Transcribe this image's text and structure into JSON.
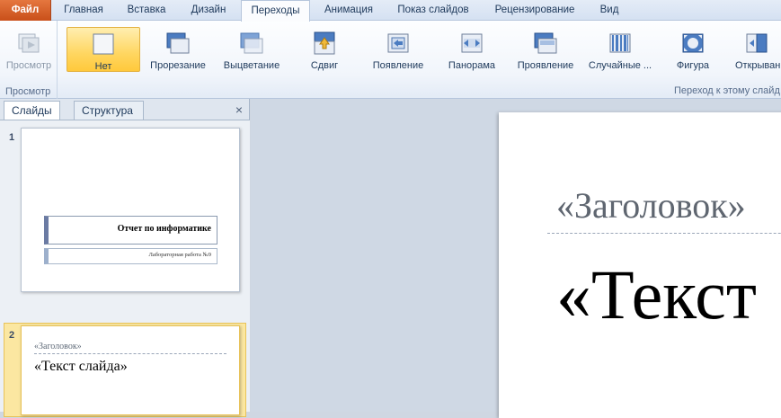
{
  "tabs": {
    "file": "Файл",
    "items": [
      "Главная",
      "Вставка",
      "Дизайн",
      "Переходы",
      "Анимация",
      "Показ слайдов",
      "Рецензирование",
      "Вид"
    ],
    "active": "Переходы"
  },
  "ribbon": {
    "preview_button": "Просмотр",
    "preview_group": "Просмотр",
    "transitions": [
      {
        "label": "Нет",
        "icon": "none-icon",
        "selected": true
      },
      {
        "label": "Прорезание",
        "icon": "cut-icon"
      },
      {
        "label": "Выцветание",
        "icon": "fade-icon"
      },
      {
        "label": "Сдвиг",
        "icon": "push-icon"
      },
      {
        "label": "Появление",
        "icon": "appear-icon"
      },
      {
        "label": "Панорама",
        "icon": "pan-icon"
      },
      {
        "label": "Проявление",
        "icon": "reveal-icon"
      },
      {
        "label": "Случайные ...",
        "icon": "random-bars-icon"
      },
      {
        "label": "Фигура",
        "icon": "shape-icon"
      },
      {
        "label": "Открыван",
        "icon": "uncover-icon"
      }
    ],
    "transitions_group": "Переход к этому слайд"
  },
  "left_pane": {
    "tab_slides": "Слайды",
    "tab_outline": "Структура",
    "close": "×",
    "slides": [
      {
        "number": "1",
        "title": "Отчет по информатике",
        "subtitle": "Лабораторная работа №9"
      },
      {
        "number": "2",
        "title": "«Заголовок»",
        "body": "«Текст слайда»"
      }
    ]
  },
  "main_slide": {
    "title": "«Заголовок»",
    "body": "«Текст"
  },
  "colors": {
    "file_tab": "#d2592a",
    "selected_button": "#ffd660",
    "selected_thumb": "#fbe7a1"
  }
}
